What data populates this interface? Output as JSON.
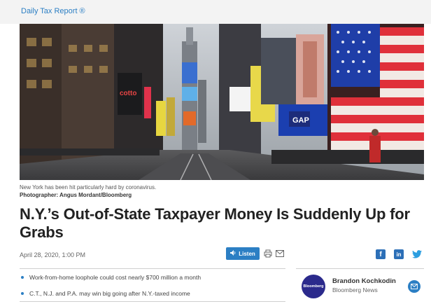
{
  "section": {
    "label": "Daily Tax Report ®"
  },
  "hero": {
    "alt_scene": "times-square-photo",
    "sign_text": "GAP",
    "sign_text_2": "cotto"
  },
  "caption": {
    "text": "New York has been hit particularly hard by coronavirus.",
    "credit": "Photographer: Angus Mordant/Bloomberg"
  },
  "article": {
    "headline": "N.Y.’s Out-of-State Taxpayer Money Is Suddenly Up for Grabs",
    "date": "April 28, 2020, 1:00 PM"
  },
  "tools": {
    "listen_label": "Listen",
    "listen_icon": "speaker-icon",
    "print_icon": "print-icon",
    "mail_icon": "mail-icon"
  },
  "social": {
    "facebook_glyph": "f",
    "linkedin_glyph": "in",
    "twitter_icon": "twitter-icon"
  },
  "bullets": [
    "Work-from-home loophole could cost nearly $700 million a month",
    "C.T., N.J. and P.A. may win big going after N.Y.-taxed income"
  ],
  "author": {
    "name": "Brandon Kochkodin",
    "org": "Bloomberg News",
    "avatar_text": "Bloomberg"
  },
  "colors": {
    "accent": "#2c7fc4",
    "avatar_bg": "#2b2a8c"
  }
}
